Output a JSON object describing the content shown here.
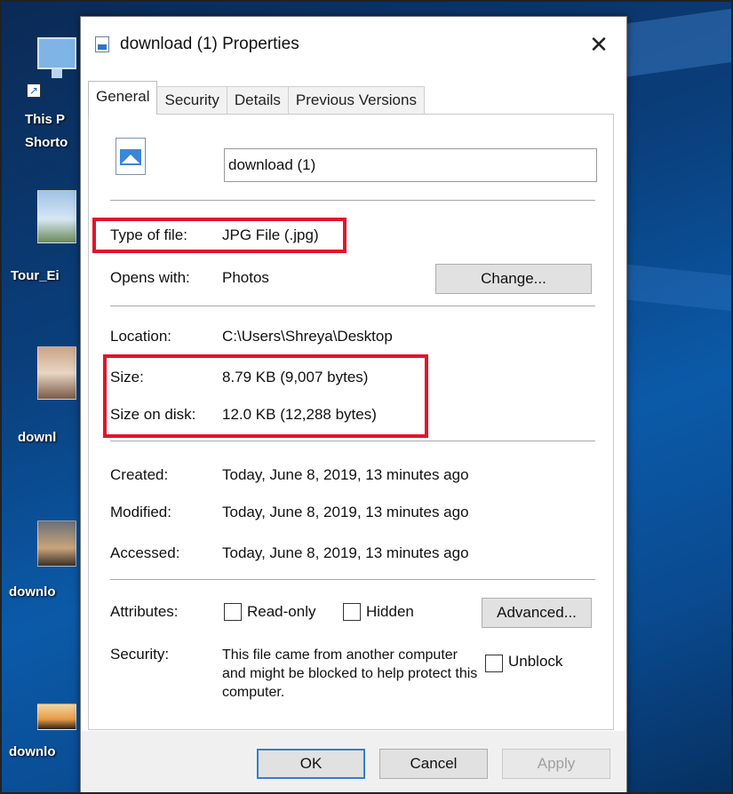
{
  "desktop": {
    "icons": [
      {
        "label_line1": "This P",
        "label_line2": "Shorto"
      },
      {
        "label": "Tour_Ei"
      },
      {
        "label": "downl"
      },
      {
        "label": "downlo"
      },
      {
        "label": "downlo"
      }
    ]
  },
  "dialog": {
    "title": "download (1) Properties",
    "close_glyph": "✕",
    "tabs": [
      {
        "label": "General",
        "active": true
      },
      {
        "label": "Security"
      },
      {
        "label": "Details"
      },
      {
        "label": "Previous Versions"
      }
    ],
    "general": {
      "file_name": "download (1)",
      "type_label": "Type of file:",
      "type_value": "JPG File (.jpg)",
      "opens_label": "Opens with:",
      "opens_value": "Photos",
      "change_button": "Change...",
      "location_label": "Location:",
      "location_value": "C:\\Users\\Shreya\\Desktop",
      "size_label": "Size:",
      "size_value": "8.79 KB (9,007 bytes)",
      "size_on_disk_label": "Size on disk:",
      "size_on_disk_value": "12.0 KB (12,288 bytes)",
      "created_label": "Created:",
      "created_value": "Today, June 8, 2019, 13 minutes ago",
      "modified_label": "Modified:",
      "modified_value": "Today, June 8, 2019, 13 minutes ago",
      "accessed_label": "Accessed:",
      "accessed_value": "Today, June 8, 2019, 13 minutes ago",
      "attributes_label": "Attributes:",
      "readonly_label": "Read-only",
      "hidden_label": "Hidden",
      "advanced_button": "Advanced...",
      "security_label": "Security:",
      "security_text": "This file came from another computer and might be blocked to help protect this computer.",
      "unblock_label": "Unblock"
    },
    "footer": {
      "ok": "OK",
      "cancel": "Cancel",
      "apply": "Apply"
    }
  },
  "colors": {
    "highlight": "#e0162b",
    "default_button_border": "#2f7fd2"
  }
}
